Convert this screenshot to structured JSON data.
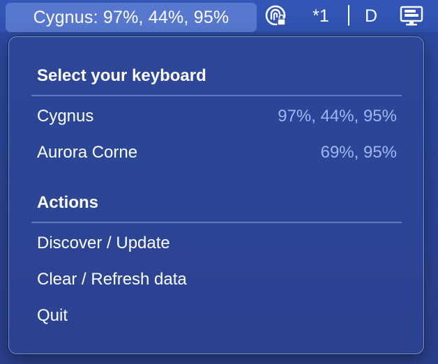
{
  "menubar": {
    "status_item_label": "Cygnus: 97%, 44%, 95%",
    "icons": [
      "lock-fingerprint-icon",
      "display-icon"
    ],
    "indicator_text": "*1",
    "input_source_letter": "D"
  },
  "menu": {
    "keyboard_heading": "Select your keyboard",
    "keyboards": [
      {
        "name": "Cygnus",
        "battery": "97%, 44%, 95%"
      },
      {
        "name": "Aurora Corne",
        "battery": "69%, 95%"
      }
    ],
    "actions_heading": "Actions",
    "actions": [
      {
        "label": "Discover / Update"
      },
      {
        "label": "Clear / Refresh data"
      },
      {
        "label": "Quit"
      }
    ]
  },
  "colors": {
    "background": "#2b4aa0",
    "menu_background": "#2c4595",
    "value_text": "#9fb7f5",
    "status_highlight": "#5f7fd0"
  }
}
